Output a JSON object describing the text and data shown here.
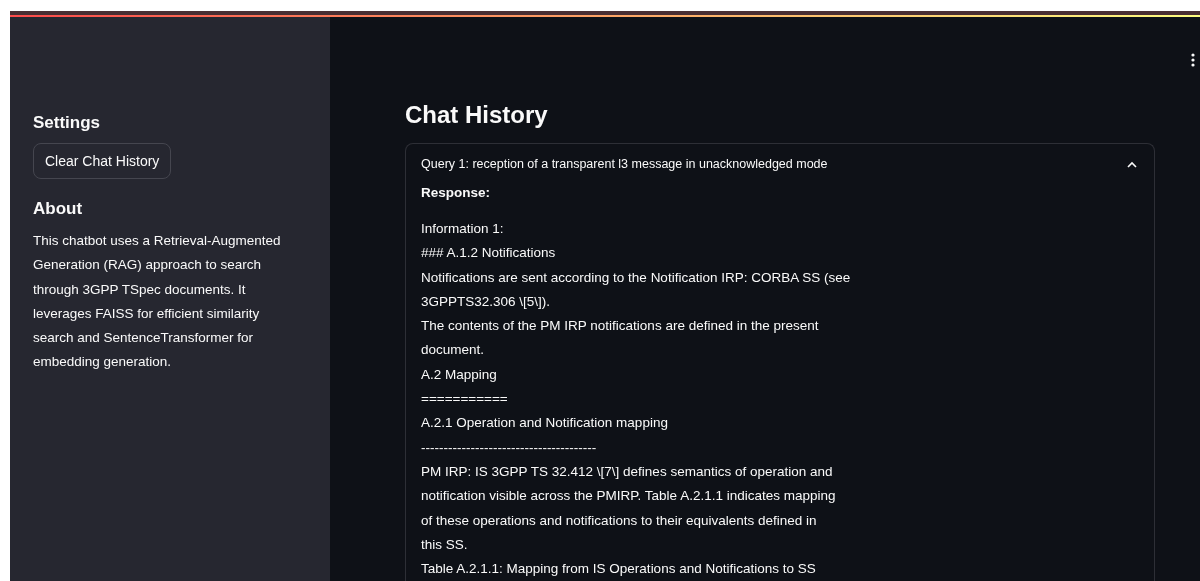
{
  "sidebar": {
    "settings_heading": "Settings",
    "clear_button": "Clear Chat History",
    "about_heading": "About",
    "about_text": "This chatbot uses a Retrieval-Augmented Generation (RAG) approach to search through 3GPP TSpec documents. It leverages FAISS for efficient similarity search and SentenceTransformer for embedding generation."
  },
  "main": {
    "title": "Chat History",
    "history": [
      {
        "query": "Query 1: reception of a transparent l3 message in unacknowledged mode",
        "expanded": true,
        "response_label": "Response:",
        "lines": [
          "Information 1:",
          "### A.1.2 Notifications",
          "Notifications are sent according to the Notification IRP: CORBA SS (see",
          "3GPPTS32.306 \\[5\\]).",
          "The contents of the PM IRP notifications are defined in the present",
          "document.",
          "A.2 Mapping",
          "===========",
          "A.2.1 Operation and Notification mapping",
          "---------------------------------------",
          "PM IRP: IS 3GPP TS 32.412 \\[7\\] defines semantics of operation and",
          "notification visible across the PMIRP. Table A.2.1.1 indicates mapping",
          "of these operations and notifications to their equivalents defined in",
          "this SS.",
          "Table A.2.1.1: Mapping from IS Operations and Notifications to SS"
        ]
      }
    ]
  }
}
